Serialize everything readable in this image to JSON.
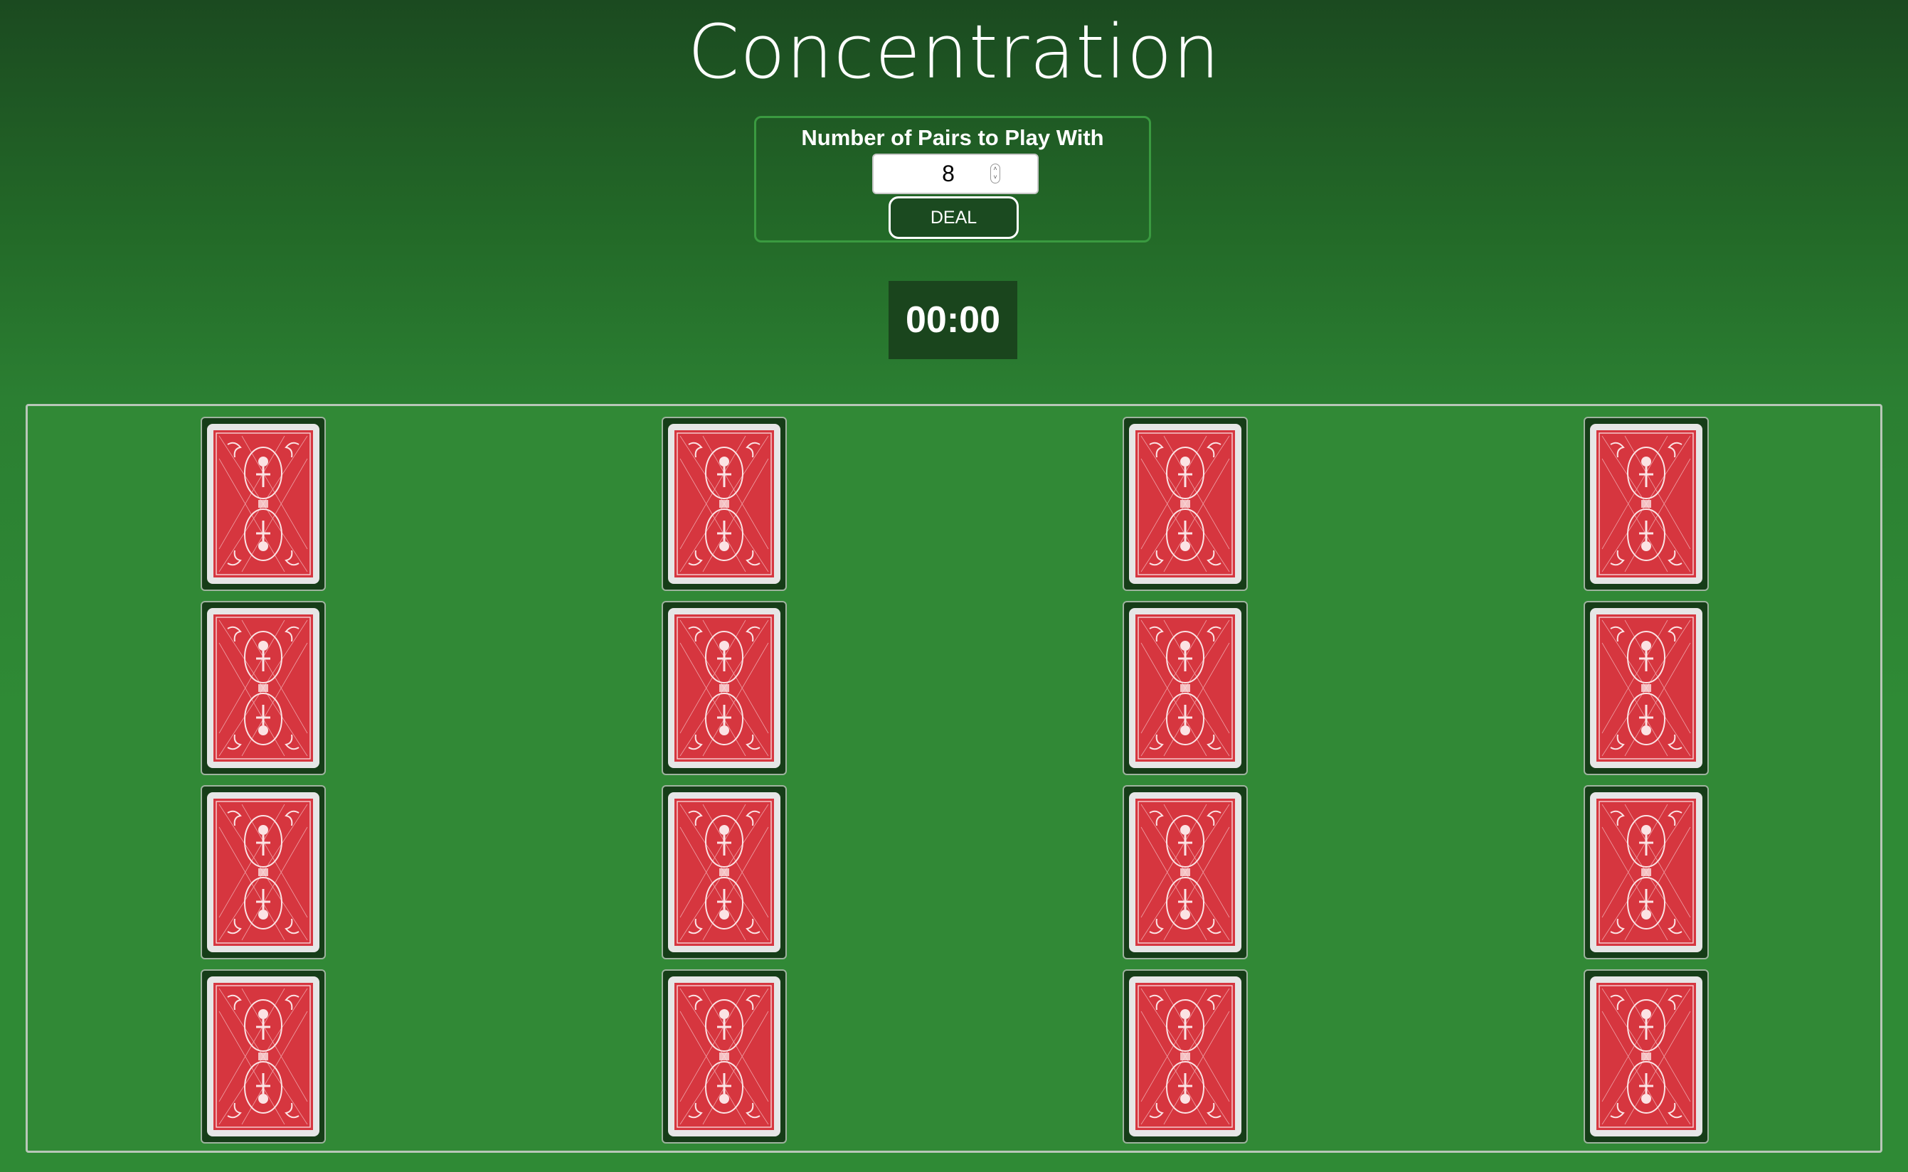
{
  "app": {
    "title": "Concentration"
  },
  "controls": {
    "label": "Number of Pairs to Play With",
    "pairs_value": "8",
    "deal_label": "DEAL"
  },
  "timer": {
    "display": "00:00"
  },
  "board": {
    "rows": 4,
    "columns": 4,
    "cards_face_down": 16
  },
  "colors": {
    "background_top": "#1b4a20",
    "board": "#318936",
    "card_back": "#d6363f",
    "card_border": "#e6e6e6",
    "timer_bg": "#1a451d"
  }
}
